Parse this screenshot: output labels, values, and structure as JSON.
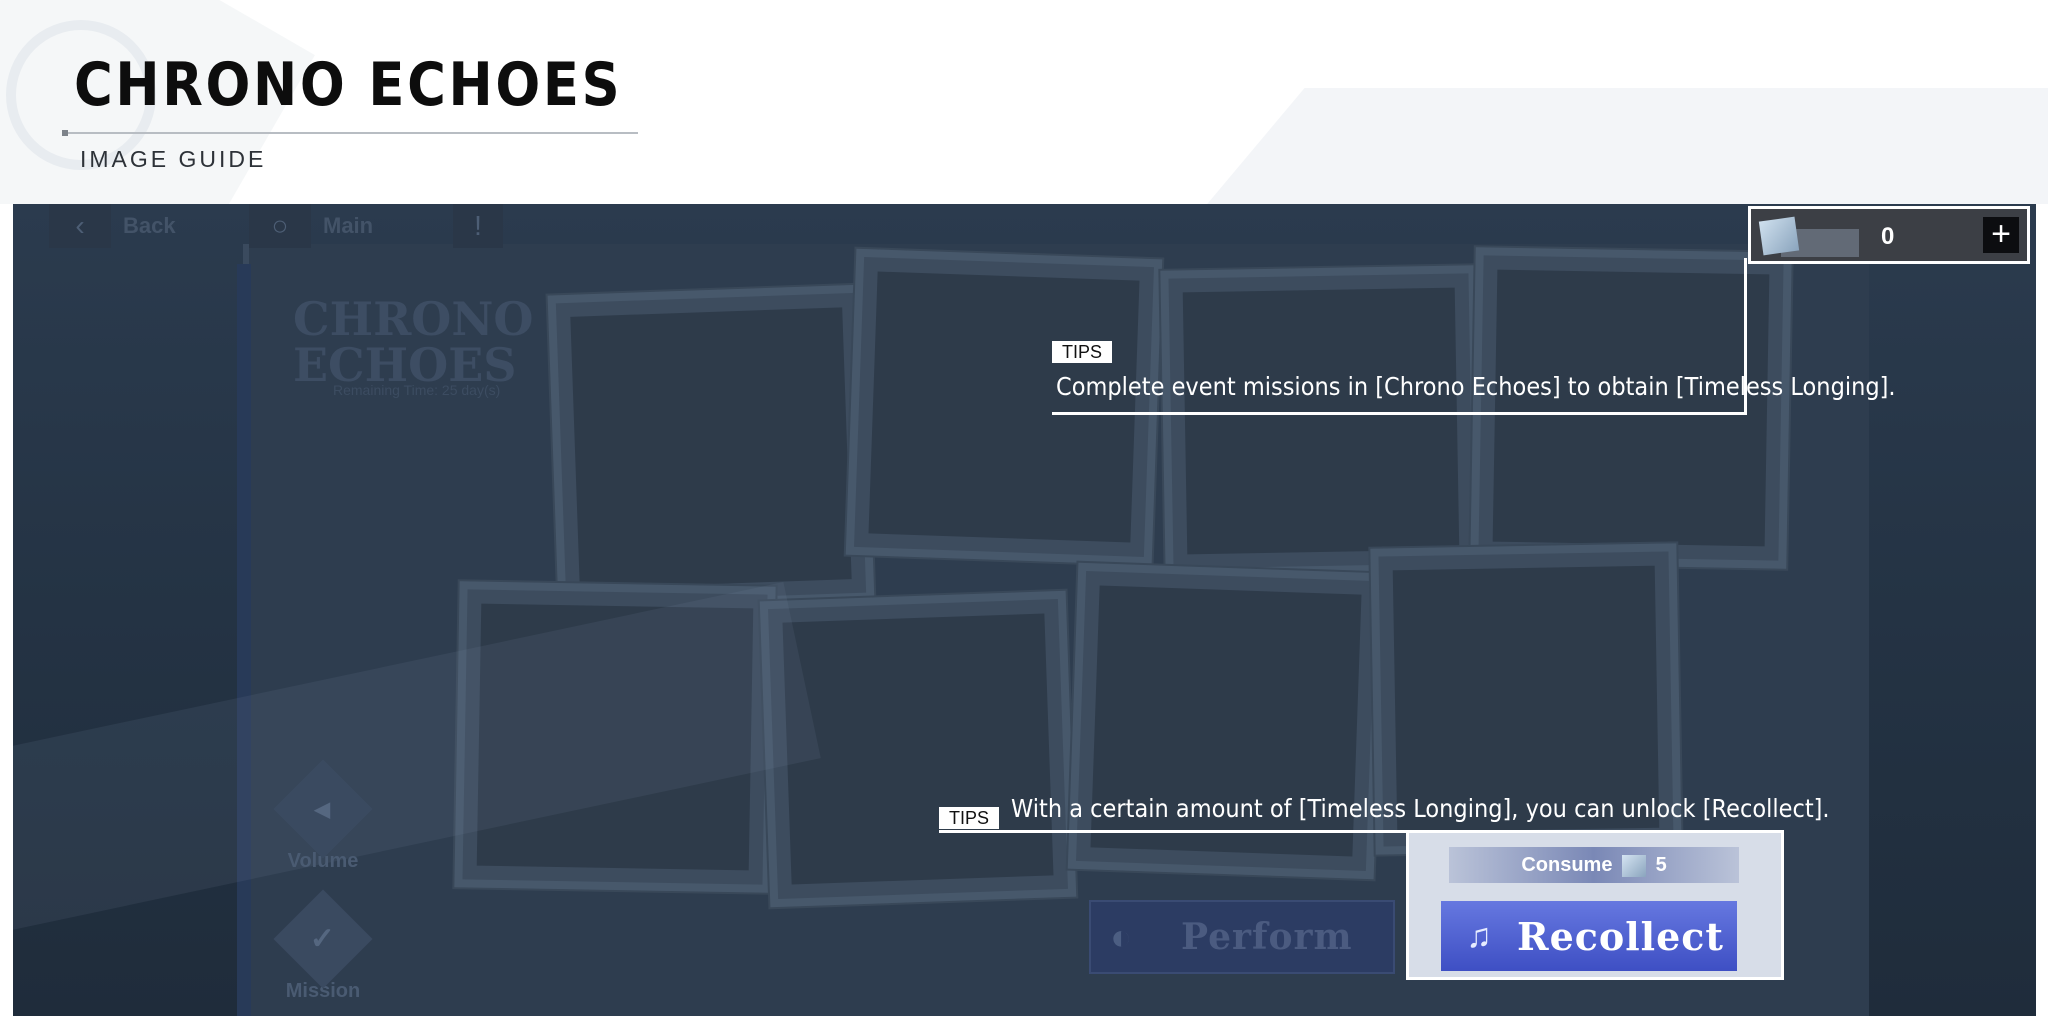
{
  "header": {
    "title": "CHRONO ECHOES",
    "subtitle": "IMAGE GUIDE"
  },
  "game": {
    "nav": {
      "back_label": "Back",
      "main_label": "Main",
      "info_glyph": "!"
    },
    "logo": {
      "line1": "CHRONO",
      "line2": "ECHOES",
      "remaining": "Remaining Time: 25 day(s)"
    },
    "side": {
      "volume_label": "Volume",
      "mission_label": "Mission"
    },
    "currency": {
      "count": "0",
      "plus": "+"
    },
    "perform_label": "Perform",
    "recollect": {
      "consume_label": "Consume",
      "consume_amount": "5",
      "button_label": "Recollect"
    },
    "colors": {
      "overlay": "#223142",
      "recollect_button": "#4b5cd0",
      "white": "#ffffff"
    }
  },
  "tips": [
    {
      "label": "TIPS",
      "text": "Complete event missions in [Chrono Echoes] to obtain [Timeless Longing]."
    },
    {
      "label": "TIPS",
      "text": "With a certain amount of [Timeless Longing], you can unlock [Recollect]."
    }
  ]
}
